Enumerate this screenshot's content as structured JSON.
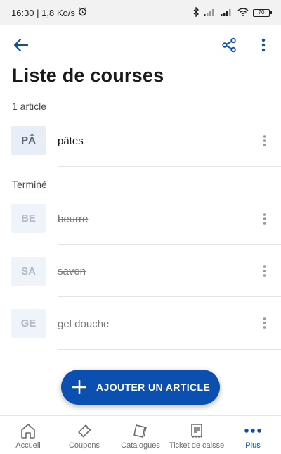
{
  "status_bar": {
    "time_speed": "16:30 | 1,8 Ko/s",
    "battery": "70"
  },
  "colors": {
    "accent": "#0b4fb0",
    "badge_active_bg": "#e8eef8",
    "badge_done_bg": "#eff3fa"
  },
  "header": {
    "back_icon": "arrow-left-icon",
    "share_icon": "share-icon",
    "more_icon": "vertical-dots-icon"
  },
  "page": {
    "title": "Liste de courses",
    "count_label": "1 article",
    "done_label": "Terminé"
  },
  "active_items": [
    {
      "badge": "PÂ",
      "label": "pâtes"
    }
  ],
  "done_items": [
    {
      "badge": "BE",
      "label": "beurre"
    },
    {
      "badge": "SA",
      "label": "savon"
    },
    {
      "badge": "GE",
      "label": "gel douche"
    }
  ],
  "fab": {
    "label": "AJOUTER UN ARTICLE",
    "icon": "plus-icon"
  },
  "bottom_nav": [
    {
      "label": "Accueil",
      "icon": "home-icon",
      "active": false
    },
    {
      "label": "Coupons",
      "icon": "ticket-icon",
      "active": false
    },
    {
      "label": "Catalogues",
      "icon": "catalog-icon",
      "active": false
    },
    {
      "label": "Ticket de caisse",
      "icon": "receipt-icon",
      "active": false
    },
    {
      "label": "Plus",
      "icon": "more-horizontal-icon",
      "active": true
    }
  ]
}
